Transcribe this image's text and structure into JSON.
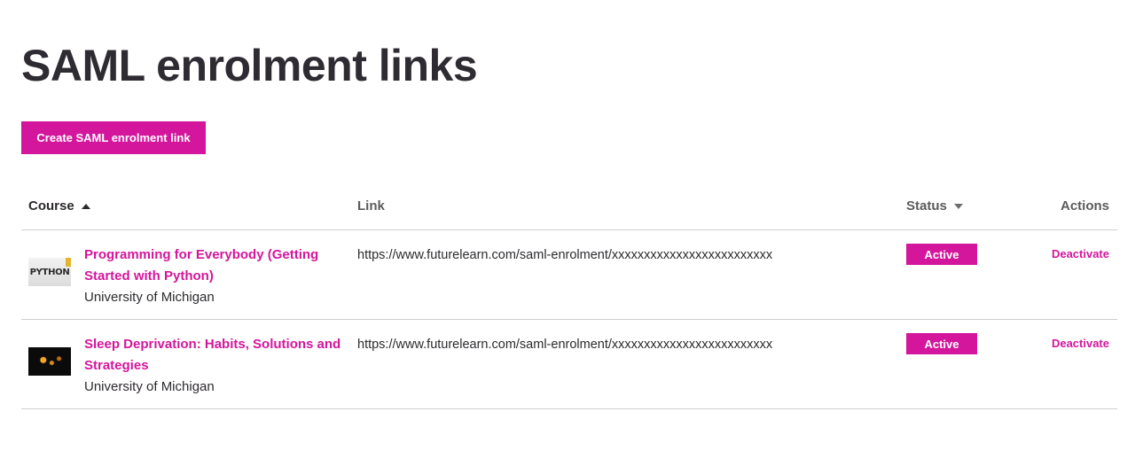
{
  "page": {
    "title": "SAML enrolment links",
    "create_button_label": "Create SAML enrolment link"
  },
  "table": {
    "headers": {
      "course": "Course",
      "link": "Link",
      "status": "Status",
      "actions": "Actions"
    },
    "rows": [
      {
        "course_title": "Programming for Everybody (Getting Started with Python)",
        "thumbnail_text": "PYTHON",
        "organisation": "University of Michigan",
        "link": "https://www.futurelearn.com/saml-enrolment/xxxxxxxxxxxxxxxxxxxxxxxxx",
        "status": "Active",
        "action": "Deactivate"
      },
      {
        "course_title": "Sleep Deprivation: Habits, Solutions and Strategies",
        "organisation": "University of Michigan",
        "link": "https://www.futurelearn.com/saml-enrolment/xxxxxxxxxxxxxxxxxxxxxxxxx",
        "status": "Active",
        "action": "Deactivate"
      }
    ]
  },
  "colors": {
    "accent": "#d4169c",
    "text": "#2d2a2e",
    "divider": "#cfcfcf"
  }
}
